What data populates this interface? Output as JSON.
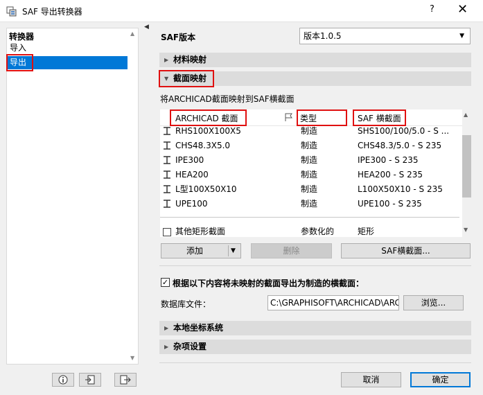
{
  "window": {
    "title": "SAF 导出转换器",
    "help": "?",
    "close": "✕"
  },
  "sidebar": {
    "header": "转换器",
    "items": [
      {
        "label": "导入"
      },
      {
        "label": "导出"
      }
    ]
  },
  "main": {
    "version_label": "SAF版本",
    "version_value": "版本1.0.5",
    "section_material": "材料映射",
    "section_profile": "截面映射",
    "profile_desc": "将ARCHICAD截面映射到SAF横截面",
    "table": {
      "headers": {
        "name": "ARCHICAD 截面",
        "type": "类型",
        "saf": "SAF 横截面"
      },
      "rows": [
        {
          "name": "RHS100X100X5",
          "type": "制造",
          "saf": "SHS100/100/5.0 - S ..."
        },
        {
          "name": "CHS48.3X5.0",
          "type": "制造",
          "saf": "CHS48.3/5.0 - S 235"
        },
        {
          "name": "IPE300",
          "type": "制造",
          "saf": "IPE300 - S 235"
        },
        {
          "name": "HEA200",
          "type": "制造",
          "saf": "HEA200 - S 235"
        },
        {
          "name": "L型100X50X10",
          "type": "制造",
          "saf": "L100X50X10 - S 235"
        },
        {
          "name": "UPE100",
          "type": "制造",
          "saf": "UPE100 - S 235"
        }
      ],
      "other_row": {
        "name": "其他矩形截面",
        "type": "参数化的",
        "saf": "矩形"
      }
    },
    "btn_add": "添加",
    "btn_delete": "删除",
    "btn_saf_profile": "SAF横截面...",
    "export_unmapped_label": "根据以下内容将未映射的截面导出为制造的横截面：",
    "database_label": "数据库文件：",
    "database_path": "C:\\GRAPHISOFT\\ARCHICAD\\ARC",
    "btn_browse": "浏览...",
    "section_local_coords": "本地坐标系统",
    "section_misc": "杂项设置",
    "btn_cancel": "取消",
    "btn_ok": "确定"
  },
  "colors": {
    "selection": "#0078d7",
    "highlight_box": "#e01010",
    "section_bg": "#dcdcdc"
  }
}
